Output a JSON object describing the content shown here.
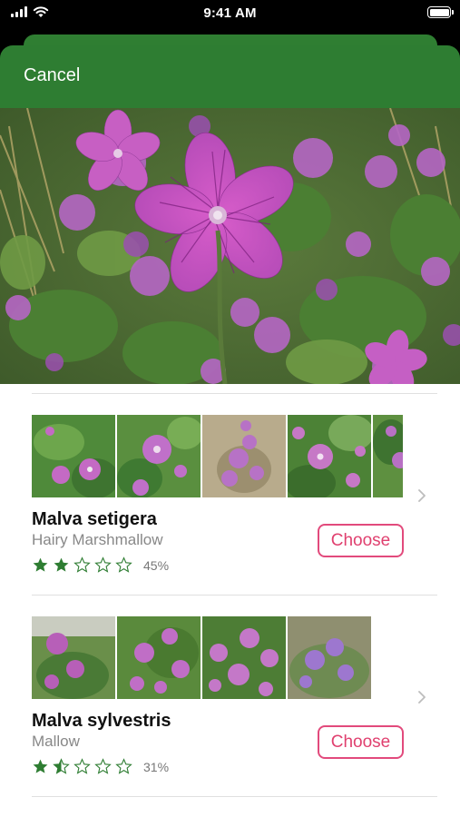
{
  "status_bar": {
    "time": "9:41 AM"
  },
  "header": {
    "cancel_label": "Cancel",
    "accent_color": "#2e7d32"
  },
  "hero": {
    "description_icon": "photo"
  },
  "results": [
    {
      "scientific_name": "Malva setigera",
      "common_name": "Hairy Marshmallow",
      "rating_stars": 2,
      "confidence": "45%",
      "choose_label": "Choose",
      "thumbnail_count": 5
    },
    {
      "scientific_name": "Malva sylvestris",
      "common_name": "Mallow",
      "rating_stars": 1.5,
      "confidence": "31%",
      "choose_label": "Choose",
      "thumbnail_count": 4
    }
  ],
  "colors": {
    "choose": "#e0406f",
    "star": "#2e7d32"
  }
}
